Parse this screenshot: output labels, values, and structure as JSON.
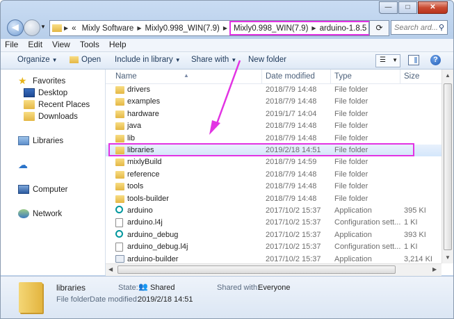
{
  "window": {
    "minimize": "—",
    "maximize": "□",
    "close": "✕"
  },
  "address": {
    "prefix": "«",
    "crumbs": [
      "Mixly Software",
      "Mixly0.998_WIN(7.9)"
    ],
    "highlighted": [
      "Mixly0.998_WIN(7.9)",
      "arduino-1.8.5"
    ],
    "search_placeholder": "Search ard...",
    "highlight_color": "#e233e3"
  },
  "menu": [
    "File",
    "Edit",
    "View",
    "Tools",
    "Help"
  ],
  "toolbar": {
    "organize": "Organize",
    "open": "Open",
    "include": "Include in library",
    "share": "Share with",
    "new_folder": "New folder",
    "help": "?"
  },
  "nav": {
    "favorites": "Favorites",
    "desktop": "Desktop",
    "recent": "Recent Places",
    "downloads": "Downloads",
    "libraries": "Libraries",
    "computer": "Computer",
    "network": "Network"
  },
  "columns": {
    "name": "Name",
    "date": "Date modified",
    "type": "Type",
    "size": "Size"
  },
  "files": [
    {
      "name": "drivers",
      "date": "2018/7/9 14:48",
      "type": "File folder",
      "size": "",
      "icon": "folder-icon"
    },
    {
      "name": "examples",
      "date": "2018/7/9 14:48",
      "type": "File folder",
      "size": "",
      "icon": "folder-icon"
    },
    {
      "name": "hardware",
      "date": "2019/1/7 14:04",
      "type": "File folder",
      "size": "",
      "icon": "folder-icon"
    },
    {
      "name": "java",
      "date": "2018/7/9 14:48",
      "type": "File folder",
      "size": "",
      "icon": "folder-icon"
    },
    {
      "name": "lib",
      "date": "2018/7/9 14:48",
      "type": "File folder",
      "size": "",
      "icon": "folder-icon"
    },
    {
      "name": "libraries",
      "date": "2019/2/18 14:51",
      "type": "File folder",
      "size": "",
      "icon": "folder-icon"
    },
    {
      "name": "mixlyBuild",
      "date": "2018/7/9 14:59",
      "type": "File folder",
      "size": "",
      "icon": "folder-icon"
    },
    {
      "name": "reference",
      "date": "2018/7/9 14:48",
      "type": "File folder",
      "size": "",
      "icon": "folder-icon"
    },
    {
      "name": "tools",
      "date": "2018/7/9 14:48",
      "type": "File folder",
      "size": "",
      "icon": "folder-icon"
    },
    {
      "name": "tools-builder",
      "date": "2018/7/9 14:48",
      "type": "File folder",
      "size": "",
      "icon": "folder-icon"
    },
    {
      "name": "arduino",
      "date": "2017/10/2 15:37",
      "type": "Application",
      "size": "395 KI",
      "icon": "arduino-icon"
    },
    {
      "name": "arduino.l4j",
      "date": "2017/10/2 15:37",
      "type": "Configuration sett...",
      "size": "1 KI",
      "icon": "config-file-icon"
    },
    {
      "name": "arduino_debug",
      "date": "2017/10/2 15:37",
      "type": "Application",
      "size": "393 KI",
      "icon": "arduino-icon"
    },
    {
      "name": "arduino_debug.l4j",
      "date": "2017/10/2 15:37",
      "type": "Configuration sett...",
      "size": "1 KI",
      "icon": "config-file-icon"
    },
    {
      "name": "arduino-builder",
      "date": "2017/10/2 15:37",
      "type": "Application",
      "size": "3,214 KI",
      "icon": "app-icon"
    }
  ],
  "selected_index": 5,
  "details": {
    "name": "libraries",
    "kind": "File folder",
    "state_label": "State:",
    "state_value": "Shared",
    "shared_label": "Shared with:",
    "shared_value": "Everyone",
    "modified_label": "Date modified:",
    "modified_value": "2019/2/18 14:51"
  }
}
